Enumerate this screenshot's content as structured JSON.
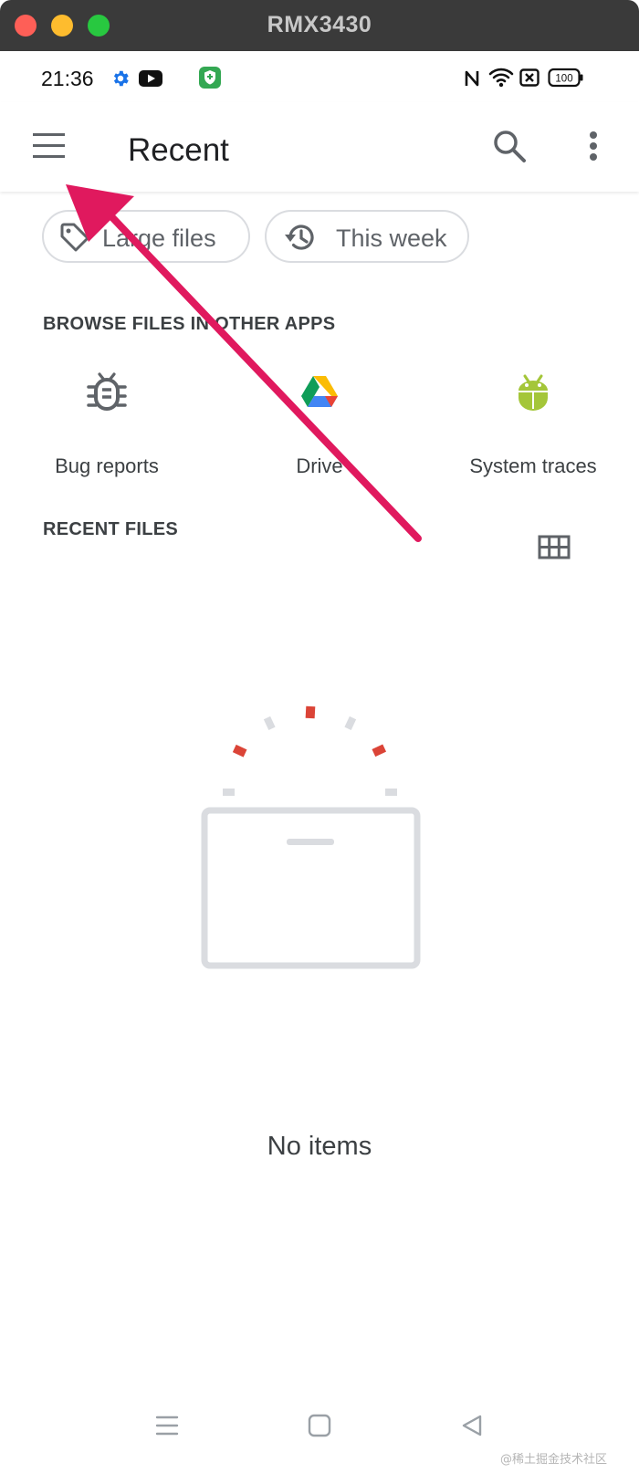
{
  "window": {
    "title": "RMX3430"
  },
  "status_bar": {
    "time": "21:36",
    "icons": [
      "gear-icon",
      "youtube-icon",
      "app-shield-icon",
      "nfc-icon",
      "wifi-icon",
      "sim-off-icon",
      "battery-icon"
    ],
    "battery_level": "100"
  },
  "app_bar": {
    "title": "Recent",
    "icons": [
      "menu-icon",
      "search-icon",
      "more-vert-icon"
    ]
  },
  "chips": [
    {
      "label": "Large files",
      "icon": "tag-icon"
    },
    {
      "label": "This week",
      "icon": "history-icon"
    }
  ],
  "browse_section": {
    "header": "BROWSE FILES IN OTHER APPS",
    "roots": [
      {
        "label": "Bug reports",
        "icon": "bug-icon"
      },
      {
        "label": "Drive",
        "icon": "google-drive-icon"
      },
      {
        "label": "System traces",
        "icon": "android-icon"
      }
    ]
  },
  "recent_section": {
    "header": "RECENT FILES",
    "view_toggle_icon": "grid-view-icon"
  },
  "empty_state": {
    "text": "No items",
    "icon": "empty-box-illustration"
  },
  "nav_bar": {
    "icons": [
      "recents-icon",
      "home-icon",
      "back-icon"
    ]
  },
  "annotation": {
    "color": "#e0195e",
    "icon": "pointer-arrow"
  },
  "watermark": "@稀土掘金技术社区"
}
